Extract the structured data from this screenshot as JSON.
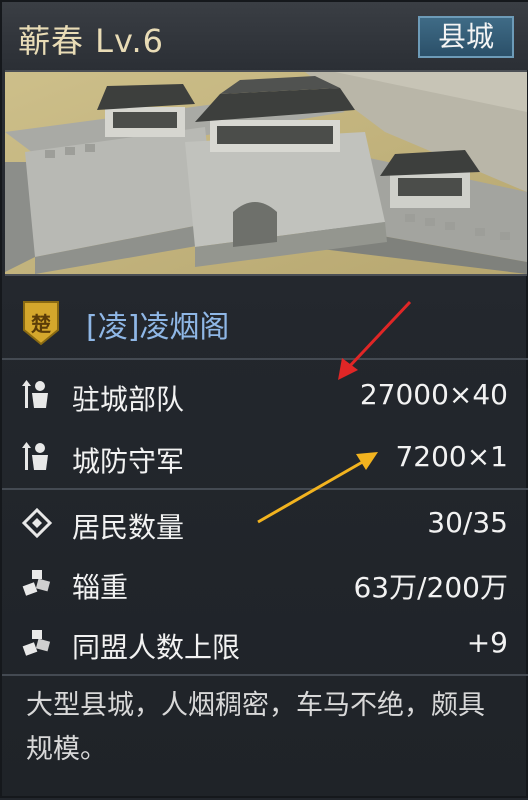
{
  "header": {
    "title": "蕲春 Lv.6",
    "city_type": "县城"
  },
  "owner": {
    "faction": "楚",
    "name": "[凌]凌烟阁"
  },
  "stats": [
    {
      "icon": "soldier-icon",
      "label": "驻城部队",
      "value": "27000×40"
    },
    {
      "icon": "soldier-icon",
      "label": "城防守军",
      "value": "7200×1"
    },
    {
      "icon": "diamond-target-icon",
      "label": "居民数量",
      "value": "30/35"
    },
    {
      "icon": "supply-icon",
      "label": "辎重",
      "value": "63万/200万"
    },
    {
      "icon": "supply-icon",
      "label": "同盟人数上限",
      "value": "+9"
    }
  ],
  "description": "大型县城，人烟稠密，车马不绝，颇具规模。",
  "colors": {
    "title": "#e9dcb6",
    "owner": "#8fb7e6",
    "badge": "#2b5069",
    "faction": "#d4a72c",
    "red_arrow": "#e02626",
    "yellow_arrow": "#f2b31f"
  }
}
